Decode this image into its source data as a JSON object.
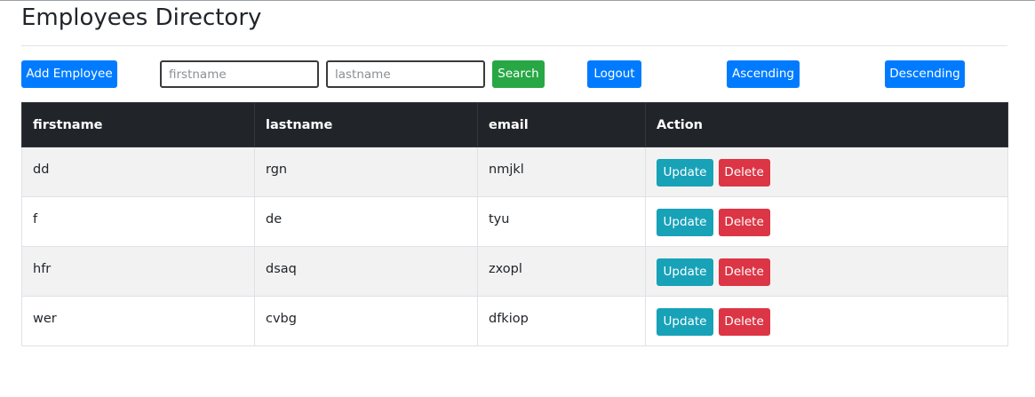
{
  "page_title": "Employees Directory",
  "toolbar": {
    "add_label": "Add Employee",
    "firstname_placeholder": "firstname",
    "lastname_placeholder": "lastname",
    "firstname_value": "",
    "lastname_value": "",
    "search_label": "Search",
    "logout_label": "Logout",
    "ascending_label": "Ascending",
    "descending_label": "Descending"
  },
  "table": {
    "headers": [
      "firstname",
      "lastname",
      "email",
      "Action"
    ],
    "rows": [
      {
        "firstname": "dd",
        "lastname": "rgn",
        "email": "nmjkl",
        "update": "Update",
        "delete": "Delete"
      },
      {
        "firstname": "f",
        "lastname": "de",
        "email": "tyu",
        "update": "Update",
        "delete": "Delete"
      },
      {
        "firstname": "hfr",
        "lastname": "dsaq",
        "email": "zxopl",
        "update": "Update",
        "delete": "Delete"
      },
      {
        "firstname": "wer",
        "lastname": "cvbg",
        "email": "dfkiop",
        "update": "Update",
        "delete": "Delete"
      }
    ]
  },
  "colors": {
    "primary": "#007bff",
    "success": "#28a745",
    "info": "#17a2b8",
    "danger": "#dc3545",
    "table_header": "#212529"
  }
}
